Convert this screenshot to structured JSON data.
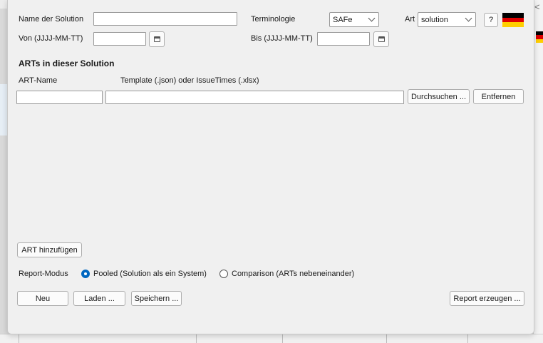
{
  "form": {
    "solution_name_label": "Name der Solution",
    "solution_name_value": "",
    "terminology_label": "Terminologie",
    "terminology_value": "SAFe",
    "art_label": "Art",
    "art_value": "solution",
    "help_label": "?",
    "from_label": "Von (JJJJ-MM-TT)",
    "from_value": "",
    "to_label": "Bis (JJJJ-MM-TT)",
    "to_value": ""
  },
  "arts": {
    "heading": "ARTs in dieser Solution",
    "col_name": "ART-Name",
    "col_template": "Template (.json) oder IssueTimes (.xlsx)",
    "rows": [
      {
        "name": "",
        "template": "",
        "browse_label": "Durchsuchen ...",
        "remove_label": "Entfernen"
      }
    ],
    "add_label": "ART hinzufügen"
  },
  "report_mode": {
    "label": "Report-Modus",
    "options": [
      {
        "label": "Pooled (Solution als ein System)",
        "selected": true
      },
      {
        "label": "Comparison (ARTs nebeneinander)",
        "selected": false
      }
    ]
  },
  "footer": {
    "new_label": "Neu",
    "load_label": "Laden ...",
    "save_label": "Speichern ...",
    "report_label": "Report erzeugen ..."
  },
  "background": {
    "close_glyph": "<"
  },
  "colors": {
    "accent": "#0067c0",
    "flag_black": "#000000",
    "flag_red": "#dd0000",
    "flag_gold": "#ffce00"
  }
}
